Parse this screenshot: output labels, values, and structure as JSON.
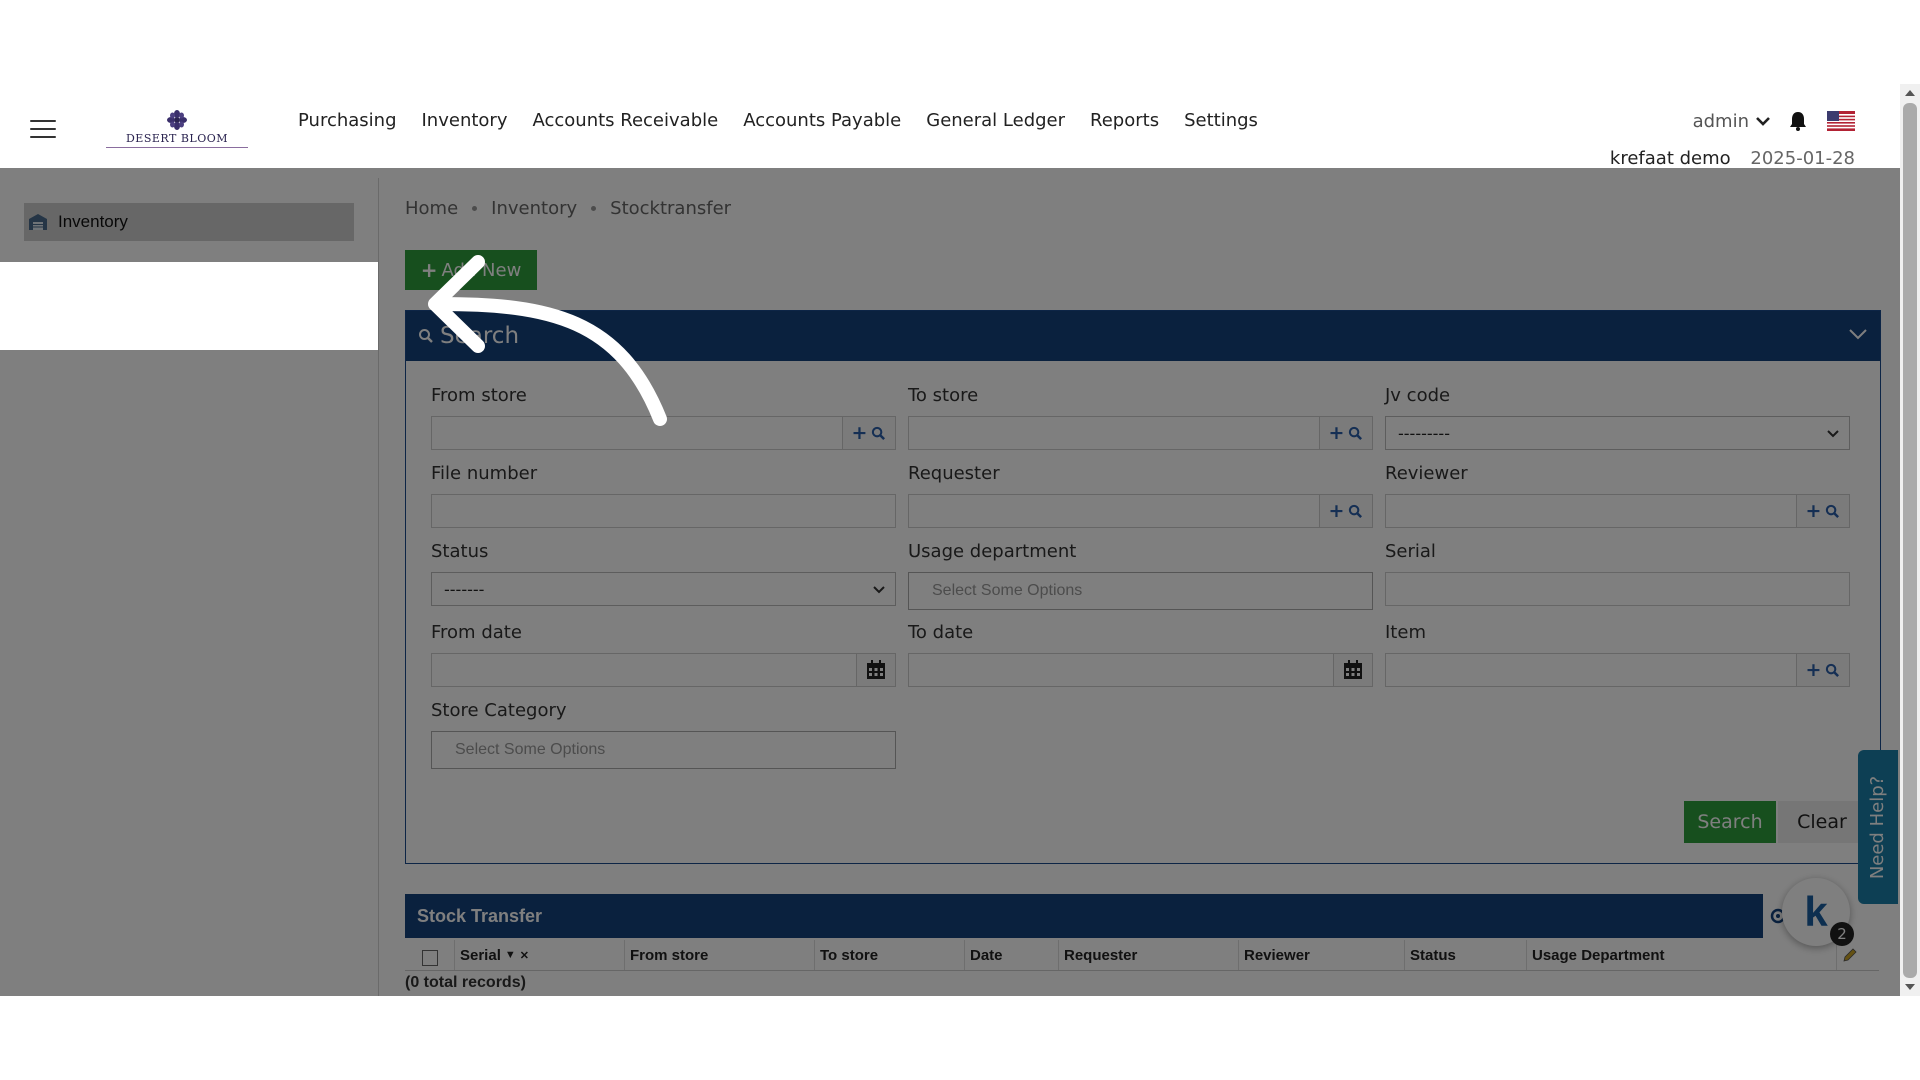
{
  "header": {
    "logo_text": "DESERT BLOOM",
    "nav": [
      "Purchasing",
      "Inventory",
      "Accounts Receivable",
      "Accounts Payable",
      "General Ledger",
      "Reports",
      "Settings"
    ],
    "user": "admin",
    "company": "krefaat demo",
    "date": "2025-01-28"
  },
  "sidebar": {
    "items": [
      {
        "label": "Inventory",
        "icon": "warehouse-icon"
      }
    ]
  },
  "breadcrumb": [
    "Home",
    "Inventory",
    "Stocktransfer"
  ],
  "toolbar": {
    "add_new_label": "Add New"
  },
  "search_panel": {
    "title": "Search",
    "fields": {
      "from_store": {
        "label": "From store",
        "value": ""
      },
      "to_store": {
        "label": "To store",
        "value": ""
      },
      "jv_code": {
        "label": "Jv code",
        "value": "---------"
      },
      "file_number": {
        "label": "File number",
        "value": ""
      },
      "requester": {
        "label": "Requester",
        "value": ""
      },
      "reviewer": {
        "label": "Reviewer",
        "value": ""
      },
      "status": {
        "label": "Status",
        "value": "-------"
      },
      "usage_department": {
        "label": "Usage department",
        "placeholder": "Select Some Options"
      },
      "serial": {
        "label": "Serial",
        "value": ""
      },
      "from_date": {
        "label": "From date",
        "value": ""
      },
      "to_date": {
        "label": "To date",
        "value": ""
      },
      "item": {
        "label": "Item",
        "value": ""
      },
      "store_category": {
        "label": "Store Category",
        "placeholder": "Select Some Options"
      }
    },
    "search_label": "Search",
    "clear_label": "Clear"
  },
  "results": {
    "title": "Stock Transfer",
    "columns": [
      "Serial",
      "From store",
      "To store",
      "Date",
      "Requester",
      "Reviewer",
      "Status",
      "Usage Department"
    ],
    "records_text": "(0 total records)"
  },
  "help": {
    "need_help_label": "Need Help?",
    "badge_count": "2",
    "bubble_letter": "k"
  },
  "colors": {
    "accent_blue": "#14427d",
    "accent_green": "#2e9e3d",
    "help_teal": "#1a7fa8"
  }
}
